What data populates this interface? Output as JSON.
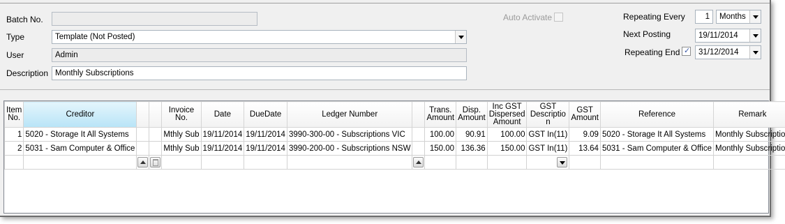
{
  "form": {
    "batch_no": {
      "label": "Batch No.",
      "value": ""
    },
    "type": {
      "label": "Type",
      "value": "Template (Not Posted)"
    },
    "user": {
      "label": "User",
      "value": "Admin"
    },
    "description": {
      "label": "Description",
      "value": "Monthly Subscriptions"
    },
    "auto_activate": {
      "label": "Auto Activate",
      "checked": false
    },
    "repeating_every": {
      "label": "Repeating Every",
      "count": "1",
      "unit": "Months"
    },
    "next_posting": {
      "label": "Next Posting",
      "value": "19/11/2014"
    },
    "repeating_end": {
      "label": "Repeating End",
      "checked": true,
      "value": "31/12/2014"
    }
  },
  "grid": {
    "headers": {
      "item_no": "Item No.",
      "creditor": "Creditor",
      "invoice_no": "Invoice No.",
      "date": "Date",
      "due_date": "DueDate",
      "ledger_number": "Ledger Number",
      "trans_amount": "Trans. Amount",
      "disp_amount": "Disp. Amount",
      "inc_gst": "Inc GST Dispersed Amount",
      "gst_description": "GST Descriptio n",
      "gst_amount": "GST Amount",
      "reference": "Reference",
      "remark": "Remark"
    },
    "rows": [
      {
        "item_no": "1",
        "creditor": "5020 - Storage It All Systems",
        "invoice_no": "Mthly Sub",
        "date": "19/11/2014",
        "due_date": "19/11/2014",
        "ledger_number": "3990-300-00 - Subscriptions VIC",
        "trans_amount": "100.00",
        "disp_amount": "90.91",
        "inc_gst": "100.00",
        "gst_description": "GST In(11)",
        "gst_amount": "9.09",
        "reference": "5020 - Storage It All Systems",
        "remark": "Monthly Subscription"
      },
      {
        "item_no": "2",
        "creditor": "5031 - Sam Computer & Office",
        "invoice_no": "Mthly Sub",
        "date": "19/11/2014",
        "due_date": "19/11/2014",
        "ledger_number": "3990-200-00 - Subscriptions NSW",
        "trans_amount": "150.00",
        "disp_amount": "136.36",
        "inc_gst": "150.00",
        "gst_description": "GST In(11)",
        "gst_amount": "13.64",
        "reference": "5031 - Sam Computer & Office",
        "remark": "Monthly Subscription"
      }
    ]
  },
  "colors": {
    "sorted_header": "#b8e4f7",
    "check_accent": "#3c5aa6"
  }
}
